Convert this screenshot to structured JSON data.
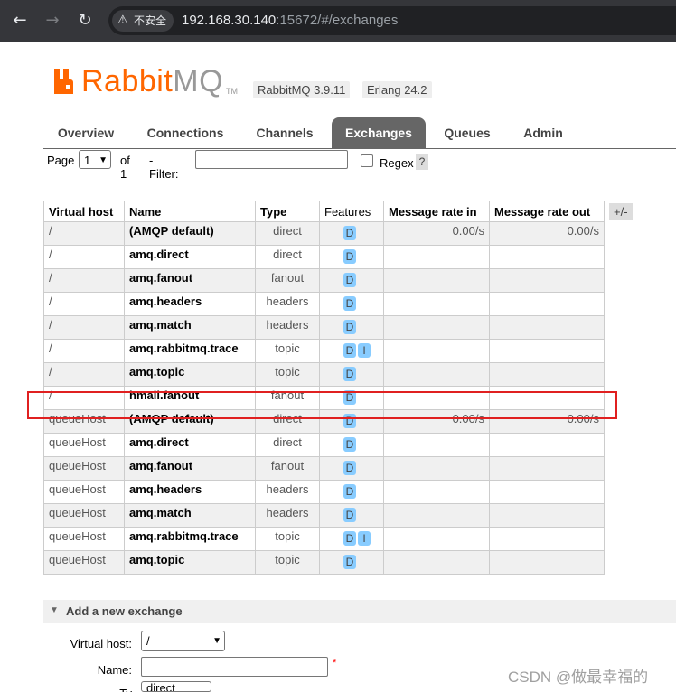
{
  "browser": {
    "security_label": "不安全",
    "url_host": "192.168.30.140",
    "url_path": ":15672/#/exchanges"
  },
  "brand": {
    "logo_rabbit": "Rabbit",
    "logo_mq": "MQ",
    "tm": "TM",
    "version": "RabbitMQ 3.9.11",
    "erlang": "Erlang 24.2",
    "accent": "#ff6600"
  },
  "tabs": [
    {
      "label": "Overview"
    },
    {
      "label": "Connections"
    },
    {
      "label": "Channels"
    },
    {
      "label": "Exchanges",
      "active": true
    },
    {
      "label": "Queues"
    },
    {
      "label": "Admin"
    }
  ],
  "pager": {
    "page_label": "Page",
    "page_value": "1",
    "of_label": "of 1",
    "filter_label": "- Filter:",
    "filter_value": "",
    "regex_label": "Regex",
    "help": "?"
  },
  "table": {
    "headers": [
      "Virtual host",
      "Name",
      "Type",
      "Features",
      "Message rate in",
      "Message rate out"
    ],
    "toggle": "+/-",
    "rows": [
      {
        "vhost": "/",
        "name": "(AMQP default)",
        "type": "direct",
        "features": [
          "D"
        ],
        "rate_in": "0.00/s",
        "rate_out": "0.00/s"
      },
      {
        "vhost": "/",
        "name": "amq.direct",
        "type": "direct",
        "features": [
          "D"
        ],
        "rate_in": "",
        "rate_out": ""
      },
      {
        "vhost": "/",
        "name": "amq.fanout",
        "type": "fanout",
        "features": [
          "D"
        ],
        "rate_in": "",
        "rate_out": ""
      },
      {
        "vhost": "/",
        "name": "amq.headers",
        "type": "headers",
        "features": [
          "D"
        ],
        "rate_in": "",
        "rate_out": ""
      },
      {
        "vhost": "/",
        "name": "amq.match",
        "type": "headers",
        "features": [
          "D"
        ],
        "rate_in": "",
        "rate_out": ""
      },
      {
        "vhost": "/",
        "name": "amq.rabbitmq.trace",
        "type": "topic",
        "features": [
          "D",
          "I"
        ],
        "rate_in": "",
        "rate_out": ""
      },
      {
        "vhost": "/",
        "name": "amq.topic",
        "type": "topic",
        "features": [
          "D"
        ],
        "rate_in": "",
        "rate_out": ""
      },
      {
        "vhost": "/",
        "name": "hmall.fanout",
        "type": "fanout",
        "features": [
          "D"
        ],
        "rate_in": "",
        "rate_out": ""
      },
      {
        "vhost": "queueHost",
        "name": "(AMQP default)",
        "type": "direct",
        "features": [
          "D"
        ],
        "rate_in": "0.00/s",
        "rate_out": "0.00/s"
      },
      {
        "vhost": "queueHost",
        "name": "amq.direct",
        "type": "direct",
        "features": [
          "D"
        ],
        "rate_in": "",
        "rate_out": ""
      },
      {
        "vhost": "queueHost",
        "name": "amq.fanout",
        "type": "fanout",
        "features": [
          "D"
        ],
        "rate_in": "",
        "rate_out": ""
      },
      {
        "vhost": "queueHost",
        "name": "amq.headers",
        "type": "headers",
        "features": [
          "D"
        ],
        "rate_in": "",
        "rate_out": ""
      },
      {
        "vhost": "queueHost",
        "name": "amq.match",
        "type": "headers",
        "features": [
          "D"
        ],
        "rate_in": "",
        "rate_out": ""
      },
      {
        "vhost": "queueHost",
        "name": "amq.rabbitmq.trace",
        "type": "topic",
        "features": [
          "D",
          "I"
        ],
        "rate_in": "",
        "rate_out": ""
      },
      {
        "vhost": "queueHost",
        "name": "amq.topic",
        "type": "topic",
        "features": [
          "D"
        ],
        "rate_in": "",
        "rate_out": ""
      }
    ]
  },
  "add_exchange": {
    "title": "Add a new exchange",
    "vhost_label": "Virtual host:",
    "vhost_value": "/",
    "name_label": "Name:",
    "name_value": "",
    "type_label": "Ty",
    "type_value": "direct",
    "required_mark": "*"
  },
  "watermark": "CSDN @做最幸福的"
}
